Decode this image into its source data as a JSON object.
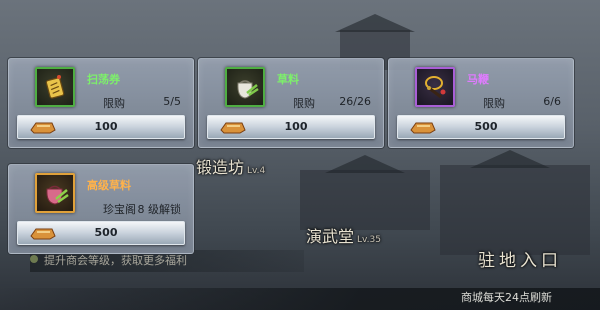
{
  "scene": {
    "buildings": [
      {
        "name": "锻造坊",
        "level": "Lv.4"
      },
      {
        "name": "演武堂",
        "level": "Lv.35"
      },
      {
        "name": "驻地入口",
        "level": ""
      }
    ],
    "tip": "提升商会等级，获取更多福利",
    "refresh_note": "商城每天24点刷新"
  },
  "items": [
    {
      "name": "扫荡券",
      "rarity": "green",
      "icon": "sweep-ticket-icon",
      "limit_label": "限购",
      "limit": "5/5",
      "price": "100",
      "currency_icon": "ingot-currency-icon"
    },
    {
      "name": "草料",
      "rarity": "green",
      "icon": "fodder-sack-icon",
      "limit_label": "限购",
      "limit": "26/26",
      "price": "100",
      "currency_icon": "ingot-currency-icon"
    },
    {
      "name": "马鞭",
      "rarity": "purple",
      "icon": "horse-whip-icon",
      "limit_label": "限购",
      "limit": "6/6",
      "price": "500",
      "currency_icon": "ingot-currency-icon"
    },
    {
      "name": "高级草料",
      "rarity": "orange",
      "icon": "premium-fodder-icon",
      "limit_label": "珍宝阁",
      "limit": "8 级解锁",
      "price": "500",
      "currency_icon": "ingot-currency-icon"
    }
  ],
  "colors": {
    "green": "#7df06a",
    "purple": "#e07bff",
    "orange": "#ffb24a"
  }
}
